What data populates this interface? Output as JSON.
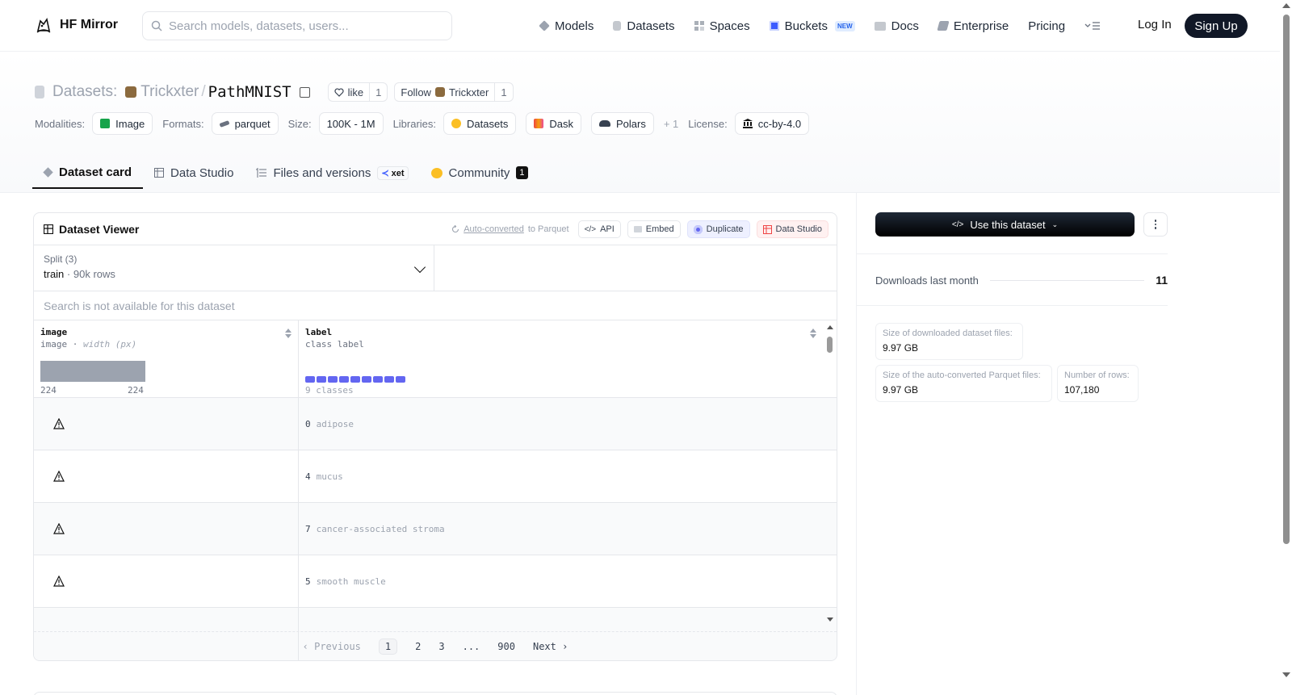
{
  "nav": {
    "brand": "HF Mirror",
    "search_placeholder": "Search models, datasets, users...",
    "links": [
      {
        "label": "Models",
        "icon": "cube-icon",
        "color": "#9ca3af"
      },
      {
        "label": "Datasets",
        "icon": "database-icon",
        "color": "#c4c8ce"
      },
      {
        "label": "Spaces",
        "icon": "grid-icon",
        "color": "#aab0b8"
      },
      {
        "label": "Buckets",
        "icon": "bucket-icon",
        "color": "#3b5bff",
        "badge": "NEW"
      },
      {
        "label": "Docs",
        "icon": "book-icon",
        "color": "#c4c8ce"
      },
      {
        "label": "Enterprise",
        "icon": "building-icon",
        "color": "#9ca3af"
      },
      {
        "label": "Pricing"
      }
    ],
    "login": "Log In",
    "signup": "Sign Up"
  },
  "header": {
    "section": "Datasets:",
    "owner": "Trickxter",
    "name": "PathMNIST",
    "like_label": "like",
    "like_count": "1",
    "follow_label": "Follow",
    "follow_owner": "Trickxter",
    "follow_count": "1",
    "modalities_label": "Modalities:",
    "modalities": "Image",
    "formats_label": "Formats:",
    "formats": "parquet",
    "size_label": "Size:",
    "size": "100K - 1M",
    "libraries_label": "Libraries:",
    "libraries": [
      "Datasets",
      "Dask",
      "Polars"
    ],
    "libraries_more": "+ 1",
    "license_label": "License:",
    "license": "cc-by-4.0"
  },
  "tabs": {
    "card": "Dataset card",
    "studio": "Data Studio",
    "files": "Files and versions",
    "xet": "xet",
    "community": "Community",
    "community_count": "1"
  },
  "viewer": {
    "title": "Dataset Viewer",
    "auto_converted": "Auto-converted",
    "to_parquet": "to Parquet",
    "api": "API",
    "embed": "Embed",
    "duplicate": "Duplicate",
    "data_studio": "Data Studio",
    "split_label": "Split (3)",
    "split_value": "train",
    "split_rows": "90k rows",
    "search_na": "Search is not available for this dataset",
    "columns": [
      {
        "name": "image",
        "type": "image",
        "type_extra": "width (px)",
        "min": "224",
        "max": "224"
      },
      {
        "name": "label",
        "type": "class label",
        "summary": "9 classes"
      }
    ],
    "rows": [
      {
        "id": "0",
        "label": "adipose"
      },
      {
        "id": "4",
        "label": "mucus"
      },
      {
        "id": "7",
        "label": "cancer-associated stroma"
      },
      {
        "id": "5",
        "label": "smooth muscle"
      }
    ],
    "pager": {
      "prev": "Previous",
      "pages": [
        "1",
        "2",
        "3",
        "...",
        "900"
      ],
      "next": "Next"
    }
  },
  "sidebar": {
    "use_button": "Use this dataset",
    "downloads_label": "Downloads last month",
    "downloads_value": "11",
    "size_downloaded_label": "Size of downloaded dataset files:",
    "size_downloaded": "9.97 GB",
    "size_parquet_label": "Size of the auto-converted Parquet files:",
    "size_parquet": "9.97 GB",
    "rows_label": "Number of rows:",
    "rows_value": "107,180"
  }
}
